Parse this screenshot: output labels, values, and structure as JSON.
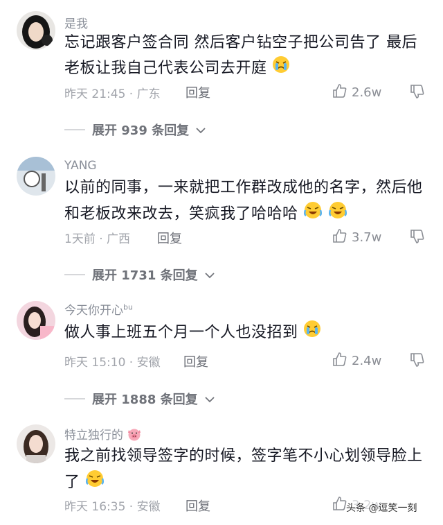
{
  "comments": [
    {
      "username": "是我",
      "text": "忘记跟客户签合同  然后客户钻空子把公司告了 最后老板让我自己代表公司去开庭",
      "time": "昨天 21:45",
      "region": "广东",
      "reply_label": "回复",
      "likes": "2.6w",
      "expand_label": "展开 939 条回复"
    },
    {
      "username": "YANG",
      "text": "以前的同事，一来就把工作群改成他的名字，然后他和老板改来改去，笑疯我了哈哈哈",
      "time": "1天前",
      "region": "广西",
      "reply_label": "回复",
      "likes": "3.7w",
      "expand_label": "展开 1731 条回复"
    },
    {
      "username": "今天你开心",
      "username_sup": "bu",
      "text": "做人事上班五个月一个人也没招到",
      "time": "昨天 15:10",
      "region": "安徽",
      "reply_label": "回复",
      "likes": "2.4w",
      "expand_label": "展开 1888 条回复"
    },
    {
      "username": "特立独行的",
      "text": "我之前找领导签字的时候，签字笔不小心划领导脸上了",
      "time": "昨天 16:35",
      "region": "安徽",
      "reply_label": "回复",
      "likes": "3.2w"
    }
  ],
  "watermark": "头条 @逗笑一刻",
  "icons": [
    "crying-emoji",
    "laughing-crying-emoji",
    "pig-emoji",
    "thumbs-up-icon",
    "thumbs-down-icon",
    "chevron-down-icon"
  ],
  "colors": {
    "text": "#161823",
    "muted": "#a1a4ab",
    "username": "#8a8f99"
  }
}
